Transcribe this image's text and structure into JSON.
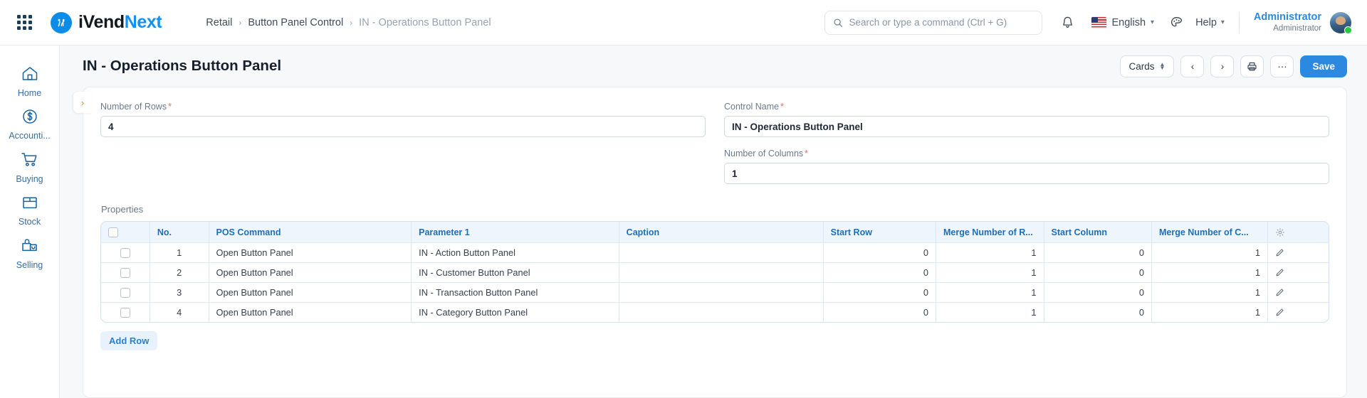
{
  "navbar": {
    "apps_icon": "apps-grid-icon",
    "brand": {
      "part1": "iVend",
      "part2": "Next",
      "mark": "iV"
    },
    "breadcrumb": [
      {
        "label": "Retail",
        "current": false
      },
      {
        "label": "Button Panel Control",
        "current": false
      },
      {
        "label": "IN - Operations Button Panel",
        "current": true
      }
    ],
    "separator": "›",
    "search": {
      "placeholder": "Search or type a command (Ctrl + G)",
      "value": ""
    },
    "notification_icon": "bell-icon",
    "language": {
      "label": "English",
      "flag": "us-flag-icon"
    },
    "theme_icon": "palette-icon",
    "help": {
      "label": "Help"
    },
    "user": {
      "name": "Administrator",
      "role": "Administrator",
      "status": "online"
    }
  },
  "sidebar": {
    "items": [
      {
        "label": "Home",
        "icon": "home-icon"
      },
      {
        "label": "Accounti...",
        "icon": "dollar-circle-icon"
      },
      {
        "label": "Buying",
        "icon": "shopping-cart-icon"
      },
      {
        "label": "Stock",
        "icon": "box-icon"
      },
      {
        "label": "Selling",
        "icon": "shopping-bag-icon"
      }
    ]
  },
  "page": {
    "title": "IN - Operations Button Panel",
    "actions": {
      "view_mode": "Cards",
      "prev": "‹",
      "next": "›",
      "print_icon": "printer-icon",
      "more": "···",
      "save": "Save"
    }
  },
  "form": {
    "collapse_chevron": "›",
    "fields": {
      "number_of_rows": {
        "label": "Number of Rows",
        "value": "4",
        "required": true
      },
      "control_name": {
        "label": "Control Name",
        "value": "IN - Operations Button Panel",
        "required": true
      },
      "number_of_columns": {
        "label": "Number of Columns",
        "value": "1",
        "required": true
      }
    }
  },
  "table": {
    "section_label": "Properties",
    "settings_icon": "gear-icon",
    "columns": [
      {
        "key": "select",
        "label": "",
        "align": "center"
      },
      {
        "key": "no",
        "label": "No.",
        "align": "center"
      },
      {
        "key": "pos_command",
        "label": "POS Command",
        "align": "left"
      },
      {
        "key": "parameter_1",
        "label": "Parameter 1",
        "align": "left"
      },
      {
        "key": "caption",
        "label": "Caption",
        "align": "left"
      },
      {
        "key": "start_row",
        "label": "Start Row",
        "align": "right"
      },
      {
        "key": "merge_rows",
        "label": "Merge Number of R...",
        "align": "right"
      },
      {
        "key": "start_column",
        "label": "Start Column",
        "align": "right"
      },
      {
        "key": "merge_columns",
        "label": "Merge Number of C...",
        "align": "right"
      },
      {
        "key": "edit",
        "label": "",
        "align": "center"
      }
    ],
    "rows": [
      {
        "no": "1",
        "pos_command": "Open Button Panel",
        "parameter_1": "IN - Action Button Panel",
        "caption": "",
        "start_row": "0",
        "merge_rows": "1",
        "start_column": "0",
        "merge_columns": "1"
      },
      {
        "no": "2",
        "pos_command": "Open Button Panel",
        "parameter_1": "IN - Customer Button Panel",
        "caption": "",
        "start_row": "0",
        "merge_rows": "1",
        "start_column": "0",
        "merge_columns": "1"
      },
      {
        "no": "3",
        "pos_command": "Open Button Panel",
        "parameter_1": "IN - Transaction Button Panel",
        "caption": "",
        "start_row": "0",
        "merge_rows": "1",
        "start_column": "0",
        "merge_columns": "1"
      },
      {
        "no": "4",
        "pos_command": "Open Button Panel",
        "parameter_1": "IN - Category Button Panel",
        "caption": "",
        "start_row": "0",
        "merge_rows": "1",
        "start_column": "0",
        "merge_columns": "1"
      }
    ],
    "add_row_label": "Add Row"
  },
  "colors": {
    "accent": "#2b8ae0",
    "brand_blue": "#1391f2",
    "table_header_bg": "#eef5fd",
    "table_header_text": "#1e6fb8",
    "required_star": "#e8705a",
    "sidebar_text": "#3a6ea5"
  }
}
